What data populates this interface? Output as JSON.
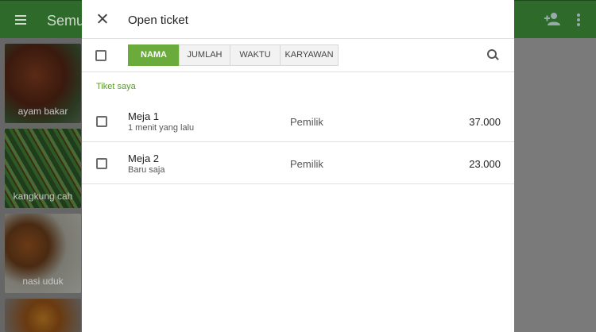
{
  "app_bar": {
    "title": "Semua",
    "menu_icon": "hamburger-menu-icon",
    "add_customer_icon": "add-person-icon",
    "more_icon": "more-vertical-icon"
  },
  "items": [
    {
      "label": "ayam bakar"
    },
    {
      "label": "kangkung cah"
    },
    {
      "label": "nasi uduk"
    },
    {
      "label": ""
    }
  ],
  "dialog": {
    "title": "Open ticket",
    "close_icon": "close-icon",
    "sort_tabs": [
      {
        "label": "NAMA",
        "active": true
      },
      {
        "label": "JUMLAH",
        "active": false
      },
      {
        "label": "WAKTU",
        "active": false
      },
      {
        "label": "KARYAWAN",
        "active": false
      }
    ],
    "search_icon": "search-icon",
    "section_label": "Tiket saya",
    "tickets": [
      {
        "name": "Meja 1",
        "time": "1 menit yang lalu",
        "owner": "Pemilik",
        "amount": "37.000",
        "checked": false
      },
      {
        "name": "Meja 2",
        "time": "Baru saja",
        "owner": "Pemilik",
        "amount": "23.000",
        "checked": false
      }
    ]
  },
  "colors": {
    "accent": "#6aab3c",
    "app_bar": "#2e6b2a",
    "section_label": "#5b9a2e"
  }
}
